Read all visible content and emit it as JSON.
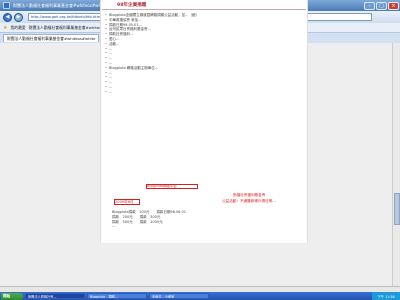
{
  "window": {
    "title": "財團法人勤福社會福利事業基金會#whiteos#white#whiteos - Windows Internet Explorer"
  },
  "toolbar": {
    "address": "http://www.goh.org.tw/fdbinfo/fdb.htm",
    "search_placeholder": "Google"
  },
  "favorites": {
    "label": "我的最愛",
    "link": "財團法人勤福社會福利事業基金會#whiteos"
  },
  "tab": {
    "label": "財團法人勤福社會福利事業基金會#whiteos#white"
  },
  "content": {
    "year_header": "98年企業捐贈",
    "items": [
      "Blogpluto全國獨立頻道暨網路捐贈公益活動，並...（續）",
      "中華救援協會 參加... ",
      "捐款日期98.05.01...",
      "台灣民眾社會福利基金會...",
      "捐助社會福利...",
      "愛心...",
      "活動...",
      "...",
      "...",
      "...",
      "...",
      "Blogpluto 網路活動主辦單位...",
      "...",
      "...",
      "...",
      "...",
      "..."
    ],
    "highlight_blog_label": "Blogpluto網路平台",
    "red_note_1": "2009年6月",
    "red_note_2": "勤福社會福利基金會",
    "red_note_3": "公益活動：不通匯款帳戶請註明…",
    "table_rows": [
      "Blogpluto捐款　100元　　捐款日期98.06.01",
      "捐款　200元　　捐款　300元",
      "捐款　500元　　捐款　1000元",
      "..."
    ]
  },
  "taskbar": {
    "start": "開始",
    "tasks": [
      "財團法人勤福社會...",
      "Blogpluto - 捐贈...",
      "未命名 - 小畫家"
    ],
    "clock": "下午 11:56"
  }
}
